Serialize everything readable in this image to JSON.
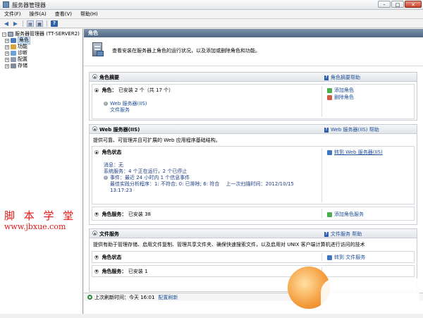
{
  "window": {
    "title": "服务器管理器",
    "controls": [
      "-",
      "□",
      "✕"
    ]
  },
  "menu": [
    "文件(F)",
    "操作(A)",
    "查看(V)",
    "帮助(H)"
  ],
  "tree": {
    "root": "服务器管理器 (TT-SERVER2)",
    "items": [
      "角色",
      "功能",
      "诊断",
      "配置",
      "存储"
    ],
    "selected": "角色"
  },
  "main": {
    "header": "角色",
    "intro": "查看安装在服务器上角色的运行状况，以及添加或删除角色和功能。"
  },
  "role_summary": {
    "title": "角色摘要",
    "help": "角色摘要帮助",
    "roles_label": "角色：",
    "roles_count": "已安装 2 个（共 17 个）",
    "roles": [
      "Web 服务器(IIS)",
      "文件服务"
    ],
    "actions": [
      "添加角色",
      "删除角色"
    ]
  },
  "web_server": {
    "title": "Web 服务器(IIS)",
    "help": "Web 服务器(IIS) 帮助",
    "desc": "提供可靠、可管理并且可扩展的 Web 应用程序基础结构。",
    "role_status_title": "角色状态",
    "goto": "转到 Web 服务器(IIS)",
    "message": "消息：无",
    "system_service": "系统服务：4 个正在运行，2 个已停止",
    "events": "事件：最近 24 小时内 1 个信息事件",
    "bpa": "最佳实践分析程序：1: 不符合; 0: 已排除; 6: 符合　 上一次扫描时间：2012/10/15",
    "bpa_time": "13:17:23",
    "role_services_label": "角色服务：",
    "role_services_count": "已安装 38",
    "add_role_services": "添加角色服务"
  },
  "file_services": {
    "title": "文件服务",
    "help": "文件服务 帮助",
    "desc": "提供有助于管理存储、启用文件复制、管理共享文件夹、确保快速搜索文件，以及启用对 UNIX 客户端计算机进行访问的技术",
    "role_status_title": "角色状态",
    "goto": "转到 文件服务",
    "role_services_label": "角色服务：",
    "role_services_count": "已安装 1"
  },
  "status": {
    "last_refresh": "上次刷新时间：今天 16:01",
    "configure": "配置刷新"
  },
  "watermark": {
    "name": "脚 本 学 堂",
    "url": "www.jbxue.com"
  }
}
